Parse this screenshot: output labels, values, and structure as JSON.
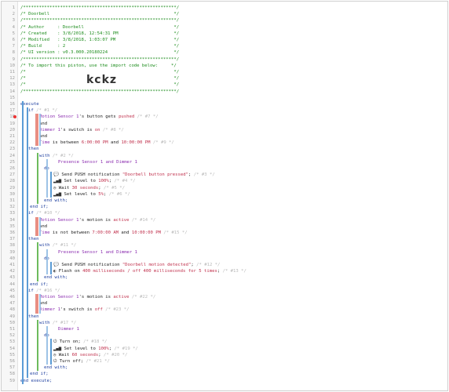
{
  "piston": {
    "import_code": "kckz",
    "header_lines": [
      "/**********************************************************/",
      "/* Doorbell                                               */",
      "/**********************************************************/",
      "/* Author     : Doorbell                                  */",
      "/* Created    : 3/8/2018, 12:54:31 PM                     */",
      "/* Modified   : 3/8/2018, 1:03:07 PM                      */",
      "/* Build      : 2                                         */",
      "/* UI version : v0.3.000.20180224                         */",
      "/**********************************************************/",
      "/* To import this piston, use the import code below:     */",
      "/*                                                        */",
      "/*                                                        */",
      "/*                                                        */",
      "/**********************************************************/"
    ]
  },
  "code": {
    "execute": "execute",
    "end_execute": "end execute;",
    "if1": {
      "if": "if",
      "comment": "/* #1 */",
      "cond1": {
        "device": "Motion Sensor 1",
        "text": "'s button gets ",
        "value": "pushed",
        "comment": "/* #7 */"
      },
      "and1": "and",
      "cond2": {
        "device": "Dimmer 1",
        "text": "'s switch is ",
        "value": "on",
        "comment": "/* #8 */"
      },
      "and2": "and",
      "cond3": {
        "device": "Time",
        "text": " is between ",
        "value1": "6:00:00 PM",
        "and": " and ",
        "value2": "10:00:00 PM",
        "comment": "/* #9 */"
      },
      "then": "then",
      "with": "with",
      "with_comment": "/* #2 */",
      "devices": "Presence Sensor 1 and Dimmer 1",
      "do": "do",
      "actions": [
        {
          "icon": "chat-icon",
          "glyph": "💬",
          "text": "Send PUSH notification ",
          "arg": "\"Doorbell button pressed\"",
          "tail": ";",
          "comment": "/* #3 */"
        },
        {
          "icon": "signal-icon",
          "glyph": "▂▄▆",
          "text": "Set level to ",
          "arg": "100%",
          "tail": ";",
          "comment": "/* #4 */"
        },
        {
          "icon": "clock-icon",
          "glyph": "◷",
          "text": "Wait ",
          "arg": "30 seconds",
          "tail": ";",
          "comment": "/* #5 */"
        },
        {
          "icon": "signal-icon",
          "glyph": "▂▄▆",
          "text": "Set level to ",
          "arg": "5%",
          "tail": ";",
          "comment": "/* #6 */"
        }
      ],
      "end_with": "end with;",
      "end_if": "end if;"
    },
    "if2": {
      "if": "if",
      "comment": "/* #10 */",
      "cond1": {
        "device": "Motion Sensor 1",
        "text": "'s motion is ",
        "value": "active",
        "comment": "/* #14 */"
      },
      "and1": "and",
      "cond2": {
        "device": "Time",
        "text": " is not between ",
        "value1": "7:00:00 AM",
        "and": " and ",
        "value2": "10:00:00 PM",
        "comment": "/* #15 */"
      },
      "then": "then",
      "with": "with",
      "with_comment": "/* #11 */",
      "devices": "Presence Sensor 1 and Dimmer 1",
      "do": "do",
      "actions": [
        {
          "icon": "chat-icon",
          "glyph": "💬",
          "text": "Send PUSH notification ",
          "arg": "\"Doorbell motion detected\"",
          "tail": ";",
          "comment": "/* #12 */"
        },
        {
          "icon": "contrast-icon",
          "glyph": "◐",
          "text": "Flash on ",
          "arg": "400 milliseconds / off 400 milliseconds for 5 times",
          "tail": ";",
          "comment": "/* #13 */"
        }
      ],
      "end_with": "end with;",
      "end_if": "end if;"
    },
    "if3": {
      "if": "if",
      "comment": "/* #16 */",
      "cond1": {
        "device": "Motion Sensor 1",
        "text": "'s motion is ",
        "value": "active",
        "comment": "/* #22 */"
      },
      "and1": "and",
      "cond2": {
        "device": "Dimmer 1",
        "text": "'s switch is ",
        "value": "off",
        "comment": "/* #23 */"
      },
      "then": "then",
      "with": "with",
      "with_comment": "/* #17 */",
      "devices": "Dimmer 1",
      "do": "do",
      "actions": [
        {
          "icon": "power-icon",
          "glyph": "⏻",
          "text": "Turn on",
          "arg": "",
          "tail": ";",
          "comment": "/* #18 */"
        },
        {
          "icon": "signal-icon",
          "glyph": "▂▄▆",
          "text": "Set level to ",
          "arg": "100%",
          "tail": ";",
          "comment": "/* #19 */"
        },
        {
          "icon": "clock-icon",
          "glyph": "◷",
          "text": "Wait ",
          "arg": "60 seconds",
          "tail": ";",
          "comment": "/* #20 */"
        },
        {
          "icon": "power-icon",
          "glyph": "⏻",
          "text": "Turn off",
          "arg": "",
          "tail": ";",
          "comment": "/* #21 */"
        }
      ],
      "end_with": "end with;",
      "end_if": "end if;"
    }
  },
  "colors": {
    "comment": "#1c8c1c",
    "keyword": "#1e3f9f",
    "device": "#8c2fb0",
    "value": "#c0304c",
    "bar_blue": "#5b9bd5",
    "bar_light": "#9dc3e6",
    "bar_green": "#6dbb5d",
    "selection": "#e98e82"
  }
}
